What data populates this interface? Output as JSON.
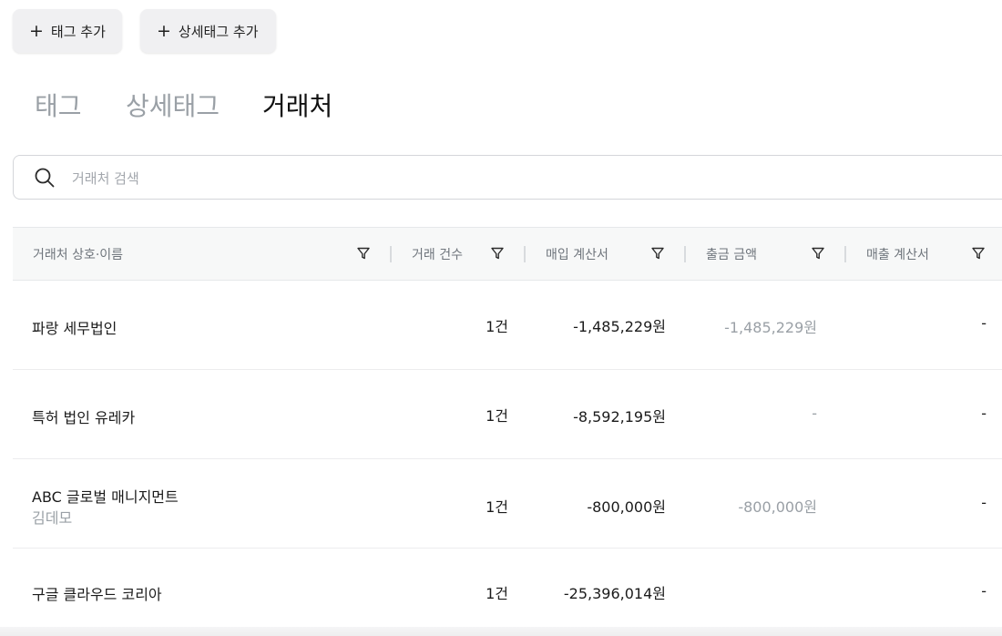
{
  "actions": {
    "add_tag": "태그 추가",
    "add_subtag": "상세태그 추가"
  },
  "tabs": [
    {
      "label": "태그",
      "active": false
    },
    {
      "label": "상세태그",
      "active": false
    },
    {
      "label": "거래처",
      "active": true
    }
  ],
  "search": {
    "placeholder": "거래처 검색",
    "value": ""
  },
  "table": {
    "columns": [
      "거래처 상호·이름",
      "거래 건수",
      "매입 계산서",
      "출금 금액",
      "매출 계산서"
    ],
    "rows": [
      {
        "name": "파랑 세무법인",
        "sub": "",
        "count": "1건",
        "purchase_invoice": "-1,485,229원",
        "withdrawal": "-1,485,229원",
        "sales_invoice": "-"
      },
      {
        "name": "특허 법인 유레카",
        "sub": "",
        "count": "1건",
        "purchase_invoice": "-8,592,195원",
        "withdrawal": "-",
        "sales_invoice": "-"
      },
      {
        "name": "ABC 글로벌 매니지먼트",
        "sub": "김데모",
        "count": "1건",
        "purchase_invoice": "-800,000원",
        "withdrawal": "-800,000원",
        "sales_invoice": "-"
      },
      {
        "name": "구글 클라우드 코리아",
        "sub": "",
        "count": "1건",
        "purchase_invoice": "-25,396,014원",
        "withdrawal": "",
        "sales_invoice": "-"
      }
    ]
  },
  "colors": {
    "active_tab": "#111111",
    "inactive_tab": "#9aa0a6",
    "header_bg": "#f7f8f8",
    "muted_text": "#9aa0a6"
  }
}
